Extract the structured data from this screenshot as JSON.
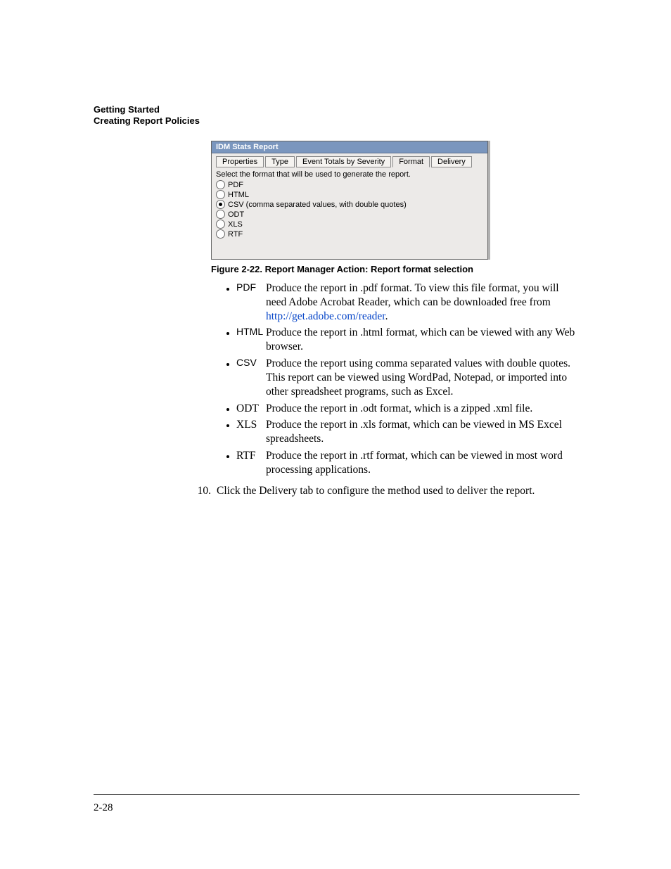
{
  "header": {
    "line1": "Getting Started",
    "line2": "Creating Report Policies"
  },
  "dialog": {
    "title": "IDM Stats Report",
    "tabs": [
      {
        "label": "Properties",
        "selected": false
      },
      {
        "label": "Type",
        "selected": false
      },
      {
        "label": "Event Totals by Severity",
        "selected": false
      },
      {
        "label": "Format",
        "selected": true
      },
      {
        "label": "Delivery",
        "selected": false
      }
    ],
    "instruction": "Select the format that will be used to generate the report.",
    "options": [
      {
        "label": "PDF",
        "selected": false
      },
      {
        "label": "HTML",
        "selected": false
      },
      {
        "label": "CSV (comma separated values, with double quotes)",
        "selected": true
      },
      {
        "label": "ODT",
        "selected": false
      },
      {
        "label": "XLS",
        "selected": false
      },
      {
        "label": "RTF",
        "selected": false
      }
    ]
  },
  "figure_caption": "Figure 2-22. Report Manager Action: Report format selection",
  "formats": {
    "pdf_term": "PDF",
    "pdf_desc_a": "Produce the report in .pdf format. To view this file format, you will need Adobe Acrobat Reader, which can be downloaded free from ",
    "pdf_link": "http://get.adobe.com/reader",
    "pdf_desc_b": ".",
    "html_term": "HTML",
    "html_desc": "Produce the report in .html format, which can be viewed with any Web browser.",
    "csv_term": "CSV",
    "csv_desc": "Produce the report using comma separated values with double quotes. This report can be viewed using WordPad, Notepad, or imported into other spreadsheet programs, such as Excel.",
    "odt_term": "ODT",
    "odt_desc": "Produce the report in .odt format, which is a zipped .xml file.",
    "xls_term": "XLS",
    "xls_desc": "Produce the report in .xls format, which can be viewed in MS Excel spreadsheets.",
    "rtf_term": "RTF",
    "rtf_desc": "Produce the report in .rtf format, which can be viewed in most word processing applications."
  },
  "step": {
    "number": "10.",
    "text": "Click the Delivery tab to configure the method used to deliver the report."
  },
  "page_number": "2-28"
}
